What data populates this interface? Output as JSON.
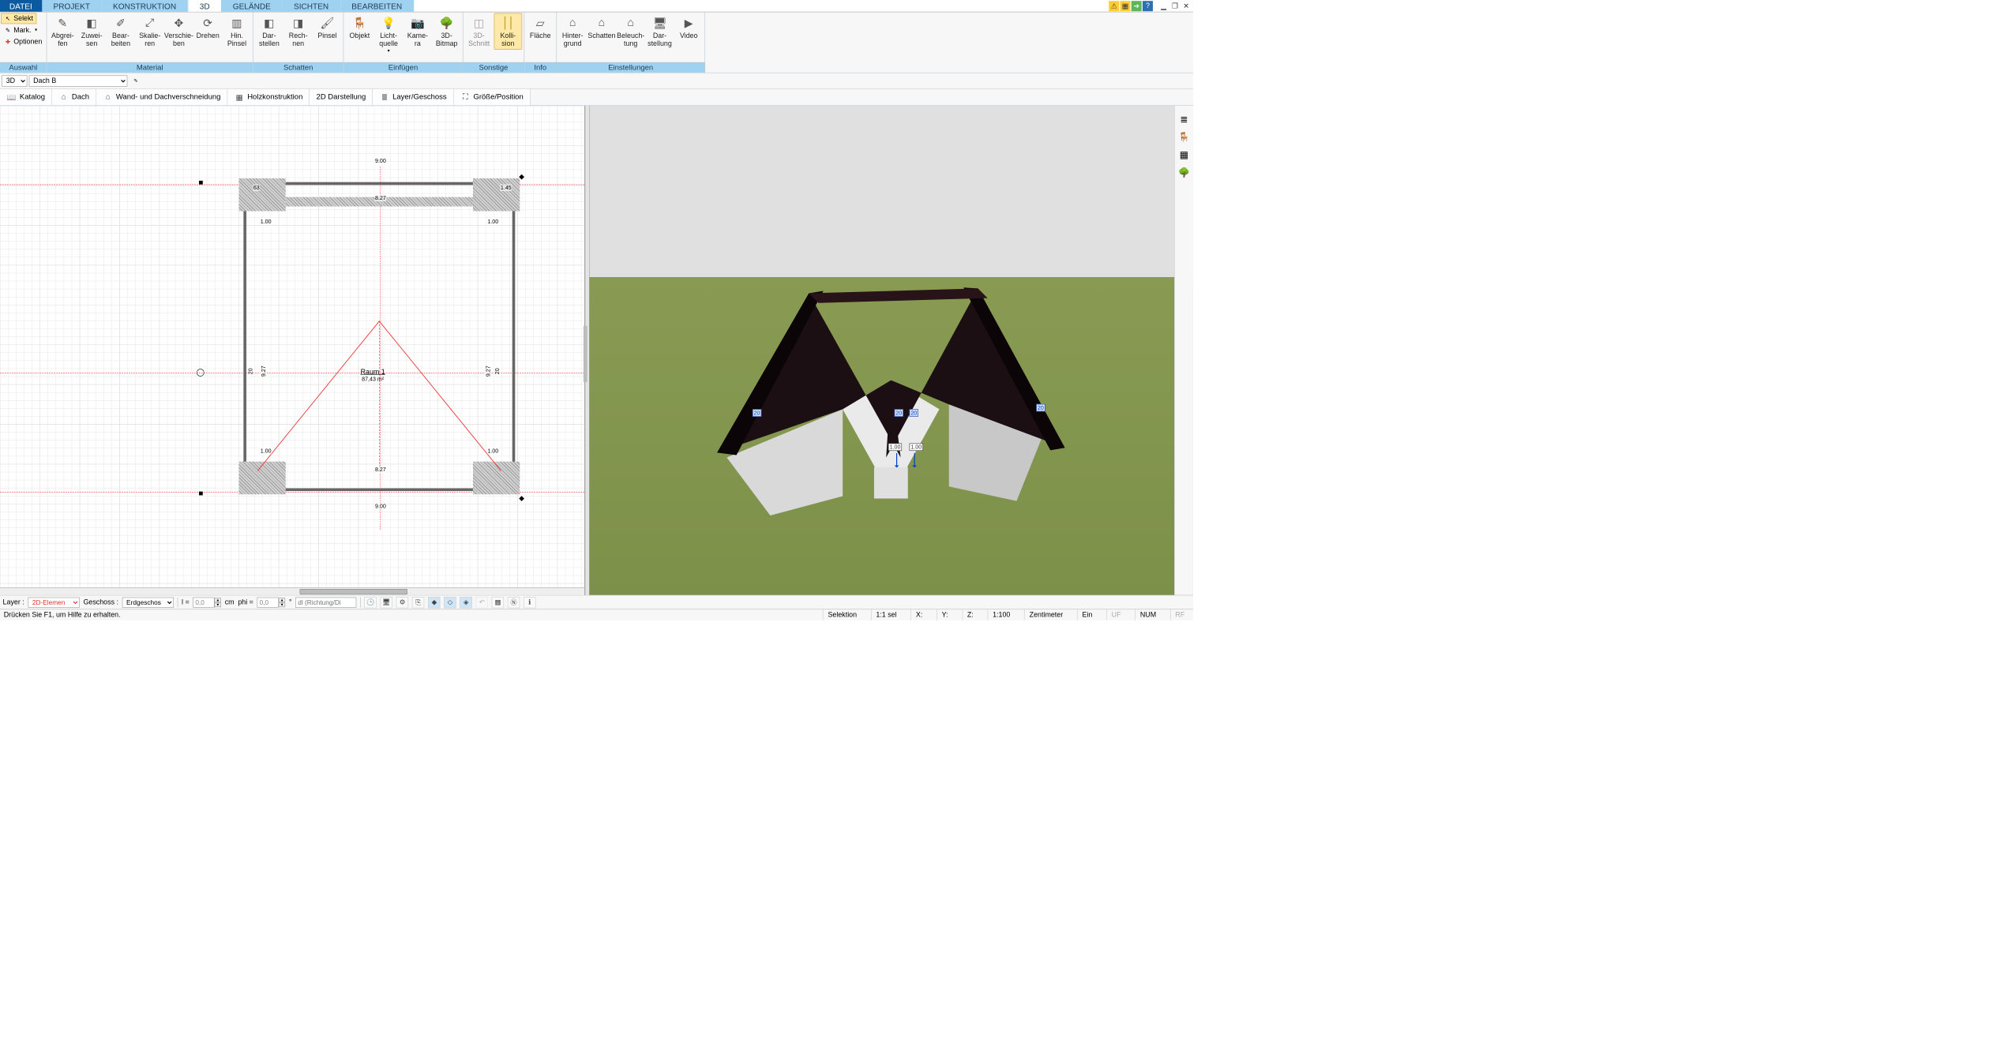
{
  "menu": {
    "file": "DATEI",
    "projekt": "PROJEKT",
    "konstruktion": "KONSTRUKTION",
    "dreid": "3D",
    "gelaende": "GELÄNDE",
    "sichten": "SICHTEN",
    "bearbeiten": "BEARBEITEN"
  },
  "sel": {
    "selekt": "Selekt",
    "mark": "Mark.",
    "optionen": "Optionen"
  },
  "ribbon": {
    "auswahl": "Auswahl",
    "material": "Material",
    "schatten": "Schatten",
    "einfuegen": "Einfügen",
    "sonstige": "Sonstige",
    "info": "Info",
    "einstellungen": "Einstellungen",
    "abgreifen": "Abgrei-\nfen",
    "zuweisen": "Zuwei-\nsen",
    "bearbeiten": "Bear-\nbeiten",
    "skalieren": "Skalie-\nren",
    "verschieben": "Verschie-\nben",
    "drehen": "Drehen",
    "hinpinsel": "Hin.\nPinsel",
    "darstellen": "Dar-\nstellen",
    "rechnen": "Rech-\nnen",
    "pinsel": "Pinsel",
    "objekt": "Objekt",
    "lichtquelle": "Licht-\nquelle",
    "kamera": "Kame-\nra",
    "bitmap3d": "3D-\nBitmap",
    "schnitt3d": "3D-\nSchnitt",
    "kollision": "Kolli-\nsion",
    "flaeche": "Fläche",
    "hintergrund": "Hinter-\ngrund",
    "schatten2": "Schatten",
    "beleuchtung": "Beleuch-\ntung",
    "darstellung": "Dar-\nstellung",
    "video": "Video"
  },
  "tb2": {
    "mode": "3D",
    "layer": "Dach B"
  },
  "tb3": {
    "katalog": "Katalog",
    "dach": "Dach",
    "wanddach": "Wand- und Dachverschneidung",
    "holz": "Holzkonstruktion",
    "darst2d": "2D Darstellung",
    "layergeschoss": "Layer/Geschoss",
    "groesse": "Größe/Position"
  },
  "plan": {
    "width_top": "9.00",
    "width_inner": "8.27",
    "roomName": "Raum 1",
    "roomArea": "87,43 m²",
    "h1": "1.00",
    "h2": "1.00",
    "h3": "1.00",
    "h4": "1.00",
    "w_bottom": "9.00",
    "w_inner2": "8.27",
    "side": "9.27",
    "corner_small": "20",
    "corner_small2": "20",
    "overhang": "63",
    "eave": "1.45"
  },
  "view3d": {
    "m20a": "20",
    "m20b": "20",
    "m20c": "20",
    "m20d": "20",
    "d1": "1.00",
    "d2": "1.00"
  },
  "bottom": {
    "layerLbl": "Layer :",
    "layerVal": "2D-Elemen",
    "geschossLbl": "Geschoss :",
    "geschossVal": "Erdgeschos",
    "lLbl": "l =",
    "lVal": "0,0",
    "cm": "cm",
    "phiLbl": "phi =",
    "phiVal": "0,0",
    "deg": "°",
    "dlPlaceholder": "dl (Richtung/Di"
  },
  "status": {
    "help": "Drücken Sie F1, um Hilfe zu erhalten.",
    "selektion": "Selektion",
    "sel": "1:1 sel",
    "x": "X:",
    "y": "Y:",
    "z": "Z:",
    "scale": "1:100",
    "unit": "Zentimeter",
    "ein": "Ein",
    "uf": "UF",
    "num": "NUM",
    "rf": "RF"
  }
}
